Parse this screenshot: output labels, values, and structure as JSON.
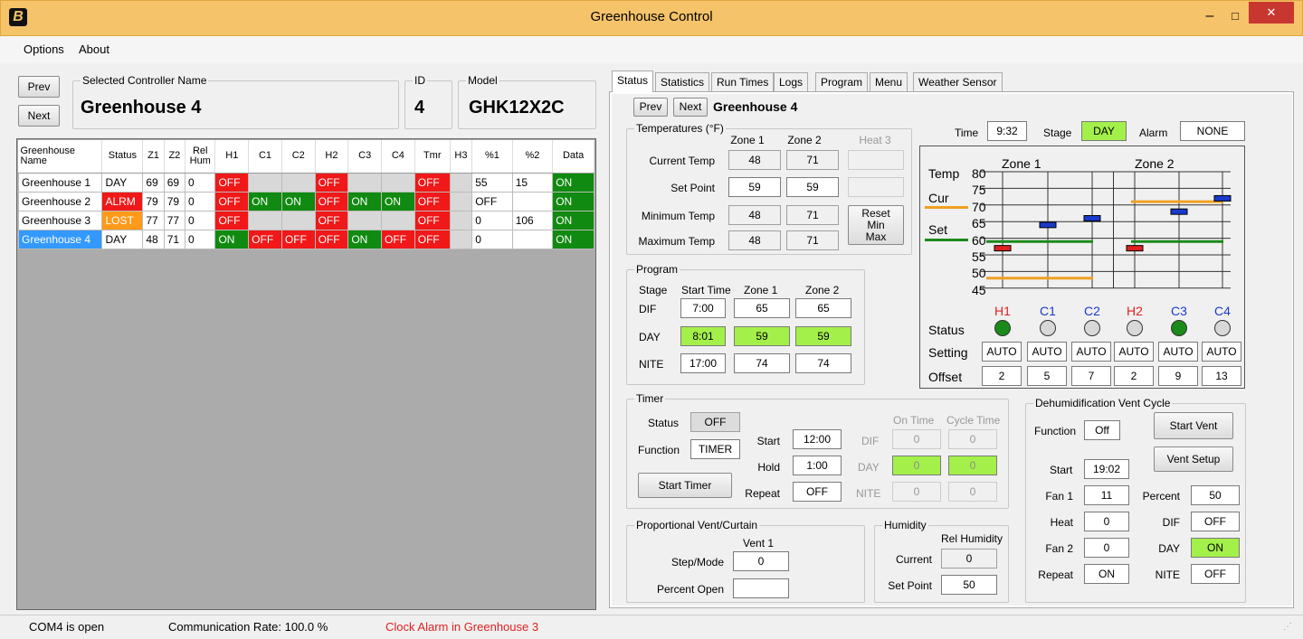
{
  "window": {
    "title": "Greenhouse Control",
    "minimize": "–",
    "maximize": "□",
    "close": "✕",
    "app_glyph": "B"
  },
  "menu": [
    "Options",
    "About"
  ],
  "left": {
    "prev": "Prev",
    "next": "Next",
    "controller_label": "Selected Controller Name",
    "controller_name": "Greenhouse 4",
    "id_label": "ID",
    "id_value": "4",
    "model_label": "Model",
    "model_value": "GHK12X2C"
  },
  "table": {
    "headers": [
      "Greenhouse Name",
      "Status",
      "Z1",
      "Z2",
      "Rel Hum",
      "H1",
      "C1",
      "C2",
      "H2",
      "C3",
      "C4",
      "Tmr",
      "H3",
      "%1",
      "%2",
      "Data"
    ],
    "rows": [
      {
        "name": "Greenhouse 1",
        "status": "DAY",
        "z1": "69",
        "z2": "69",
        "rh": "0",
        "h1": "OFF",
        "c1": "",
        "c2": "",
        "h2": "OFF",
        "c3": "",
        "c4": "",
        "tmr": "OFF",
        "h3": "",
        "p1": "55",
        "p2": "15",
        "data": "ON"
      },
      {
        "name": "Greenhouse 2",
        "status": "ALRM",
        "z1": "79",
        "z2": "79",
        "rh": "0",
        "h1": "OFF",
        "c1": "ON",
        "c2": "ON",
        "h2": "OFF",
        "c3": "ON",
        "c4": "ON",
        "tmr": "OFF",
        "h3": "",
        "p1": "OFF",
        "p2": "",
        "data": "ON"
      },
      {
        "name": "Greenhouse 3",
        "status": "LOST",
        "z1": "77",
        "z2": "77",
        "rh": "0",
        "h1": "OFF",
        "c1": "",
        "c2": "",
        "h2": "OFF",
        "c3": "",
        "c4": "",
        "tmr": "OFF",
        "h3": "",
        "p1": "0",
        "p2": "106",
        "data": "ON"
      },
      {
        "name": "Greenhouse 4",
        "status": "DAY",
        "z1": "48",
        "z2": "71",
        "rh": "0",
        "h1": "ON",
        "c1": "OFF",
        "c2": "OFF",
        "h2": "OFF",
        "c3": "ON",
        "c4": "OFF",
        "tmr": "OFF",
        "h3": "",
        "p1": "0",
        "p2": "",
        "data": "ON"
      }
    ]
  },
  "tabs": [
    "Status",
    "Statistics",
    "Run Times",
    "Logs",
    "Program",
    "Menu",
    "Weather Sensor"
  ],
  "right": {
    "prev": "Prev",
    "next": "Next",
    "name": "Greenhouse 4",
    "temps": {
      "title": "Temperatures (°F)",
      "zone1": "Zone 1",
      "zone2": "Zone 2",
      "heat3": "Heat 3",
      "current_label": "Current Temp",
      "current1": "48",
      "current2": "71",
      "set_label": "Set Point",
      "set1": "59",
      "set2": "59",
      "min_label": "Minimum Temp",
      "min1": "48",
      "min2": "71",
      "max_label": "Maximum Temp",
      "max1": "48",
      "max2": "71",
      "reset": "Reset Min Max"
    },
    "program": {
      "title": "Program",
      "stage": "Stage",
      "start": "Start Time",
      "zone1": "Zone 1",
      "zone2": "Zone 2",
      "dif": "DIF",
      "dif_start": "7:00",
      "dif_z1": "65",
      "dif_z2": "65",
      "day": "DAY",
      "day_start": "8:01",
      "day_z1": "59",
      "day_z2": "59",
      "nite": "NITE",
      "nite_start": "17:00",
      "nite_z1": "74",
      "nite_z2": "74"
    },
    "top": {
      "time_label": "Time",
      "time": "9:32",
      "stage_label": "Stage",
      "stage": "DAY",
      "alarm_label": "Alarm",
      "alarm": "NONE"
    },
    "graph": {
      "temp": "Temp",
      "cur": "Cur",
      "set": "Set",
      "zone1": "Zone 1",
      "zone2": "Zone 2",
      "ticks": [
        "80",
        "75",
        "70",
        "65",
        "60",
        "55",
        "50",
        "45"
      ],
      "outputs": [
        "H1",
        "C1",
        "C2",
        "H2",
        "C3",
        "C4"
      ],
      "status_label": "Status",
      "setting_label": "Setting",
      "offset_label": "Offset",
      "settings": [
        "AUTO",
        "AUTO",
        "AUTO",
        "AUTO",
        "AUTO",
        "AUTO"
      ],
      "offsets": [
        "2",
        "5",
        "7",
        "2",
        "9",
        "13"
      ],
      "status_on": [
        true,
        false,
        false,
        false,
        true,
        false
      ],
      "heat_color": "#e02020",
      "cool_color": "#1a3acc",
      "cur_color": "#f0a020",
      "set_color": "#1a8a1a"
    },
    "timer": {
      "title": "Timer",
      "status_label": "Status",
      "status": "OFF",
      "function_label": "Function",
      "function": "TIMER",
      "start_btn": "Start Timer",
      "start_label": "Start",
      "start": "12:00",
      "hold_label": "Hold",
      "hold": "1:00",
      "repeat_label": "Repeat",
      "repeat": "OFF",
      "on_time": "On Time",
      "cycle_time": "Cycle Time",
      "dif": "DIF",
      "day": "DAY",
      "nite": "NITE",
      "dif_on": "0",
      "dif_cycle": "0",
      "day_on": "0",
      "day_cycle": "0",
      "nite_on": "0",
      "nite_cycle": "0"
    },
    "vent": {
      "title": "Proportional Vent/Curtain",
      "vent1": "Vent 1",
      "step_label": "Step/Mode",
      "step": "0",
      "percent_label": "Percent Open",
      "percent": ""
    },
    "humidity": {
      "title": "Humidity",
      "rel": "Rel Humidity",
      "current_label": "Current",
      "current": "0",
      "set_label": "Set Point",
      "set": "50"
    },
    "dehum": {
      "title": "Dehumidification Vent Cycle",
      "function_label": "Function",
      "function": "Off",
      "start_vent": "Start Vent",
      "vent_setup": "Vent Setup",
      "start_label": "Start",
      "start": "19:02",
      "fan1_label": "Fan 1",
      "fan1": "11",
      "percent_label": "Percent",
      "percent": "50",
      "heat_label": "Heat",
      "heat": "0",
      "dif_label": "DIF",
      "dif": "OFF",
      "fan2_label": "Fan 2",
      "fan2": "0",
      "day_label": "DAY",
      "day": "ON",
      "repeat_label": "Repeat",
      "repeat": "ON",
      "nite_label": "NITE",
      "nite": "OFF"
    }
  },
  "status": {
    "port": "COM4 is open",
    "rate": "Communication Rate: 100.0 %",
    "alarm": "Clock Alarm in Greenhouse 3",
    "alarm_color": "#e02020"
  }
}
